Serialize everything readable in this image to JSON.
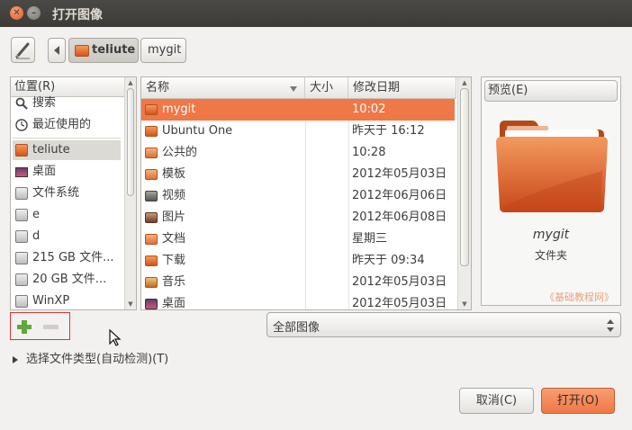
{
  "window": {
    "title": "打开图像"
  },
  "pathbar": {
    "segments": [
      "teliute",
      "mygit"
    ]
  },
  "places": {
    "header": "位置(R)",
    "items": [
      {
        "label": "搜索",
        "icon": "search-icon"
      },
      {
        "label": "最近使用的",
        "icon": "clock-icon"
      },
      {
        "label": "teliute",
        "icon": "home-folder-icon"
      },
      {
        "label": "桌面",
        "icon": "desktop-icon"
      },
      {
        "label": "文件系统",
        "icon": "drive-icon"
      },
      {
        "label": "e",
        "icon": "drive-icon"
      },
      {
        "label": "d",
        "icon": "drive-icon"
      },
      {
        "label": "215 GB 文件...",
        "icon": "drive-icon"
      },
      {
        "label": "20 GB 文件...",
        "icon": "drive-icon"
      },
      {
        "label": "WinXP",
        "icon": "drive-icon"
      }
    ]
  },
  "files": {
    "columns": {
      "name": "名称",
      "size": "大小",
      "date": "修改日期"
    },
    "rows": [
      {
        "name": "mygit",
        "size": "",
        "date": "10:02"
      },
      {
        "name": "Ubuntu One",
        "size": "",
        "date": "昨天于 16:12"
      },
      {
        "name": "公共的",
        "size": "",
        "date": "10:28"
      },
      {
        "name": "模板",
        "size": "",
        "date": "2012年05月03日"
      },
      {
        "name": "视频",
        "size": "",
        "date": "2012年06月06日"
      },
      {
        "name": "图片",
        "size": "",
        "date": "2012年06月08日"
      },
      {
        "name": "文档",
        "size": "",
        "date": "星期三"
      },
      {
        "name": "下载",
        "size": "",
        "date": "昨天于 09:34"
      },
      {
        "name": "音乐",
        "size": "",
        "date": "2012年05月03日"
      },
      {
        "name": "桌面",
        "size": "",
        "date": "2012年05月03日"
      }
    ]
  },
  "preview": {
    "header": "预览(E)",
    "name": "mygit",
    "type": "文件夹",
    "watermark": "《基础教程网》"
  },
  "filter": {
    "selected": "全部图像"
  },
  "filetype_expander": "选择文件类型(自动检测)(T)",
  "buttons": {
    "cancel": "取消(C)",
    "open": "打开(O)"
  },
  "colors": {
    "accent": "#f07746",
    "titlebar": "#3c3b37"
  }
}
